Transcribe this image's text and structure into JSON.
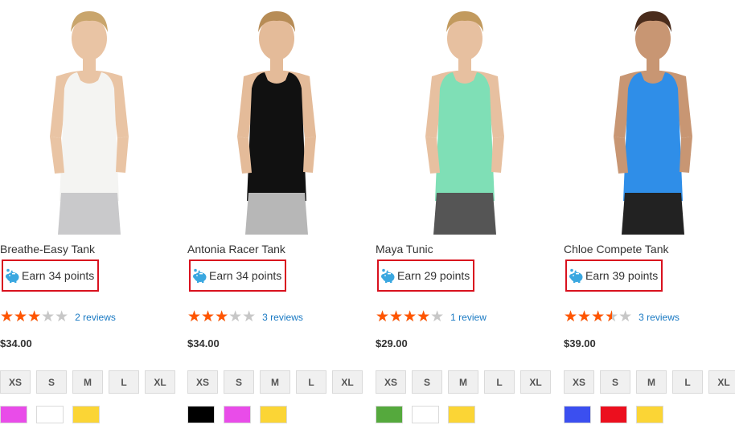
{
  "products": [
    {
      "name": "Breathe-Easy Tank",
      "points_label": "Earn 34 points",
      "rating": 0.6,
      "reviews": "2 reviews",
      "price": "$34.00",
      "sizes": [
        "XS",
        "S",
        "M",
        "L",
        "XL"
      ],
      "swatches": [
        "#e94ce9",
        "#ffffff",
        "#fbd535"
      ],
      "image": {
        "top_color": "#f4f4f2",
        "bottom_color": "#c9c9cb",
        "skin": "#e9c4a4",
        "hair": "#c9a56c"
      }
    },
    {
      "name": "Antonia Racer Tank",
      "points_label": "Earn 34 points",
      "rating": 0.6,
      "reviews": "3 reviews",
      "price": "$34.00",
      "sizes": [
        "XS",
        "S",
        "M",
        "L",
        "XL"
      ],
      "swatches": [
        "#000000",
        "#e94ce9",
        "#fbd535"
      ],
      "image": {
        "top_color": "#111111",
        "bottom_color": "#b7b7b7",
        "skin": "#e4bb99",
        "hair": "#b78c56"
      }
    },
    {
      "name": "Maya Tunic",
      "points_label": "Earn 29 points",
      "rating": 0.8,
      "reviews": "1 review",
      "price": "$29.00",
      "sizes": [
        "XS",
        "S",
        "M",
        "L",
        "XL"
      ],
      "swatches": [
        "#55a93d",
        "#ffffff",
        "#fbd535"
      ],
      "image": {
        "top_color": "#7fdfb6",
        "bottom_color": "#555555",
        "skin": "#e7c0a0",
        "hair": "#c29a5e"
      }
    },
    {
      "name": "Chloe Compete Tank",
      "points_label": "Earn 39 points",
      "rating": 0.7,
      "reviews": "3 reviews",
      "price": "$39.00",
      "sizes": [
        "XS",
        "S",
        "M",
        "L",
        "XL"
      ],
      "swatches": [
        "#3b4ff0",
        "#ec0f1e",
        "#fbd535"
      ],
      "image": {
        "top_color": "#2f8ee8",
        "bottom_color": "#222222",
        "skin": "#c89673",
        "hair": "#4a2c1c"
      }
    }
  ],
  "colors": {
    "highlight_border": "#d9111e",
    "star_on": "#ff5501",
    "star_off": "#c7c7c7",
    "link": "#1979c3",
    "piggy": "#3aa7e0"
  }
}
